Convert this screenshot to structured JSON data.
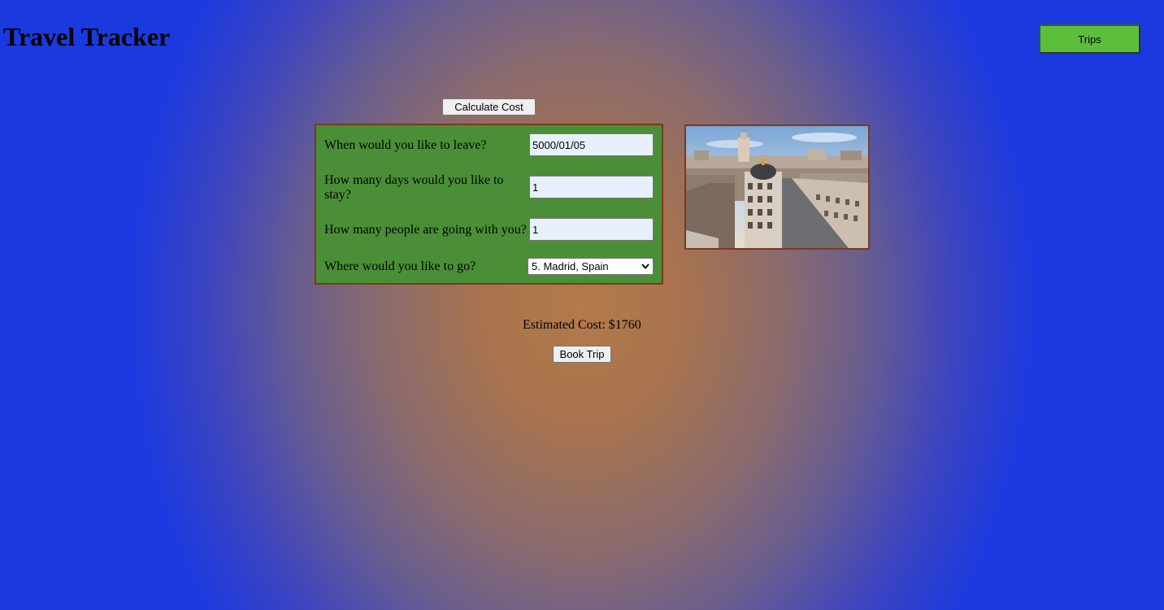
{
  "app": {
    "title": "Travel Tracker"
  },
  "nav": {
    "trips_label": "Trips"
  },
  "actions": {
    "calculate_label": "Calculate Cost",
    "book_label": "Book Trip"
  },
  "form": {
    "leave_question": "When would you like to leave?",
    "leave_value": "5000/01/05",
    "days_question": "How many days would you like to stay?",
    "days_value": "1",
    "people_question": "How many people are going with you?",
    "people_value": "1",
    "destination_question": "Where would you like to go?",
    "destination_selected": "5. Madrid, Spain"
  },
  "result": {
    "estimated_cost": "Estimated Cost: $1760"
  },
  "destination_image": {
    "icon": "madrid-city-photo"
  },
  "colors": {
    "panel_green": "#4a8f37",
    "panel_border": "#7a3a1a",
    "trips_button": "#5cbf3c",
    "input_bg": "#e8f0fe",
    "bg_center": "#b37a4a",
    "bg_edge": "#1a3ae0"
  }
}
